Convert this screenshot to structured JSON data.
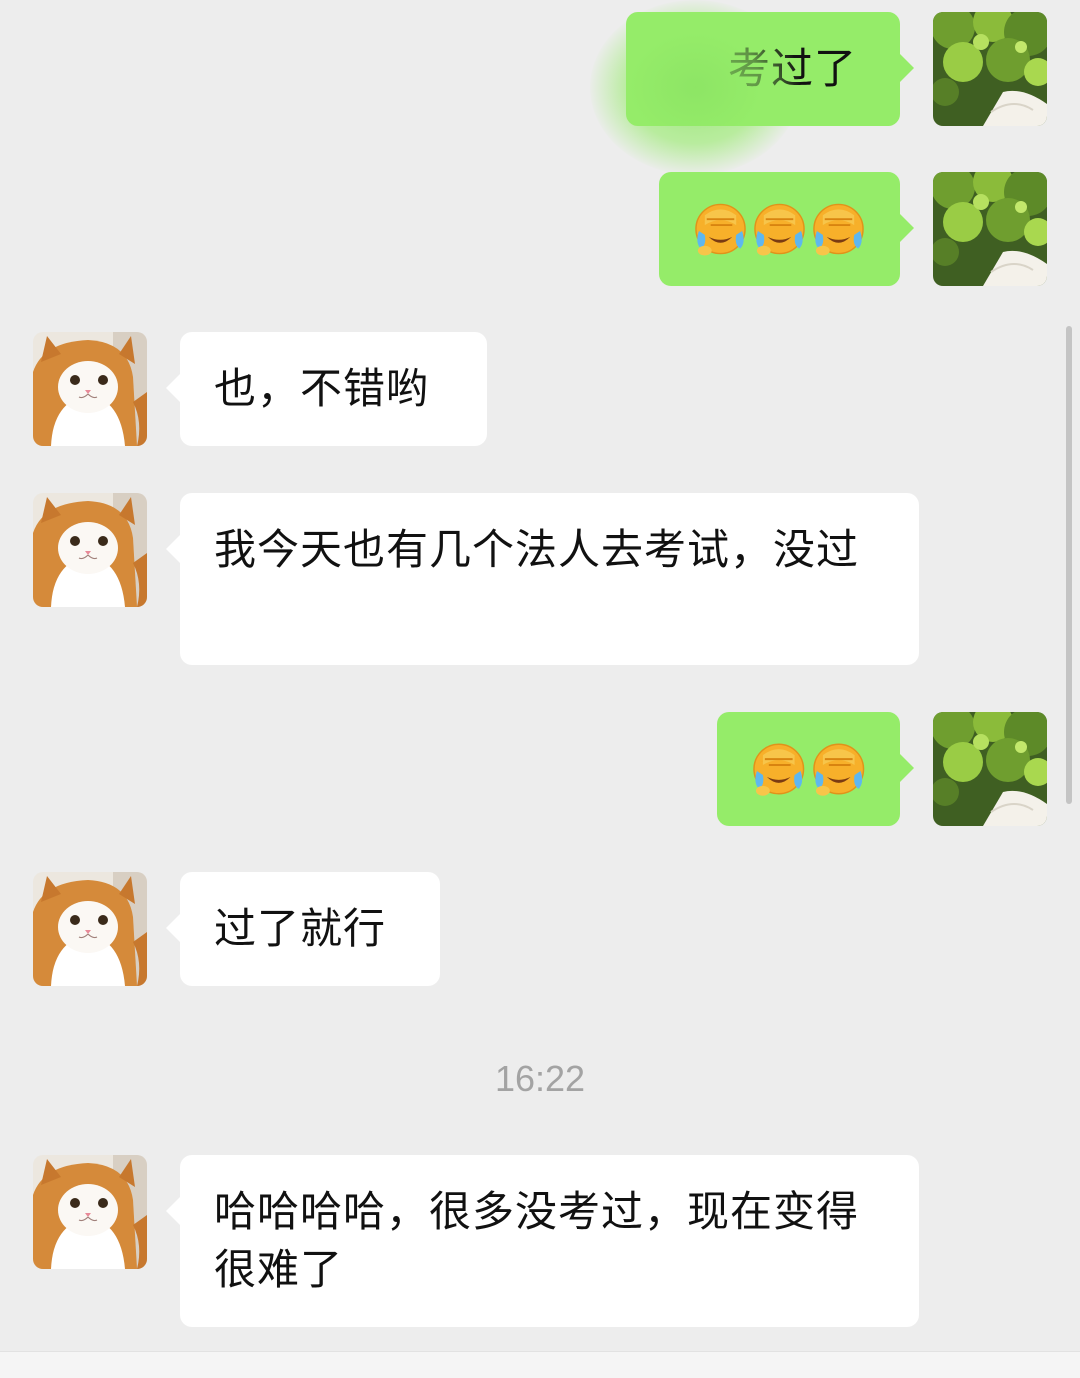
{
  "messages": [
    {
      "side": "out",
      "type": "text",
      "text": "考过了"
    },
    {
      "side": "out",
      "type": "emoji",
      "count": 3,
      "emoji": "face-palm-crying-emoji"
    },
    {
      "side": "in",
      "type": "text",
      "text": "也，不错哟"
    },
    {
      "side": "in",
      "type": "text",
      "text": "我今天也有几个法人去考试，没过"
    },
    {
      "side": "out",
      "type": "emoji",
      "count": 2,
      "emoji": "face-palm-crying-emoji"
    },
    {
      "side": "in",
      "type": "text",
      "text": "过了就行"
    },
    {
      "side": "in",
      "type": "text",
      "text": "哈哈哈哈，很多没考过，现在变得很难了"
    }
  ],
  "timestamp": "16:22",
  "avatars": {
    "self": "leafy-tree-avatar",
    "contact": "orange-white-cat-avatar"
  },
  "colors": {
    "background": "#ededed",
    "outgoing_bubble": "#95ec69",
    "incoming_bubble": "#ffffff",
    "timestamp": "#a3a3a3"
  }
}
